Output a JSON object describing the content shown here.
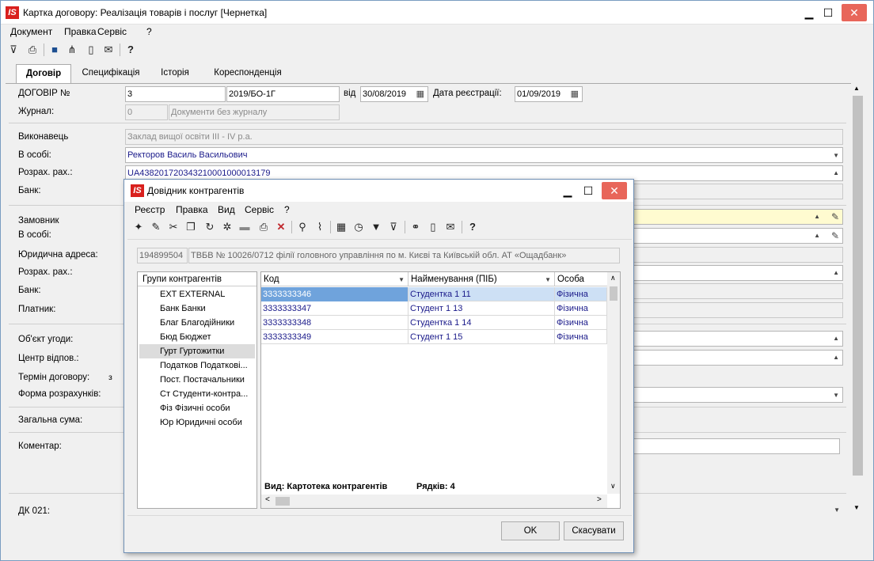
{
  "window": {
    "title": "Картка договору:  Реалізація товарів і послуг [Чернетка]",
    "logo": "IS",
    "controls": {
      "minimize": "▁",
      "maximize": "☐",
      "close": "✕"
    }
  },
  "menu": [
    "Документ",
    "Правка",
    "Сервіс",
    "?"
  ],
  "toolbar_icons": [
    "filter-icon",
    "print-icon",
    "save-icon",
    "tree-icon",
    "document-icon",
    "mail-icon",
    "help-icon"
  ],
  "tabs": [
    "Договір",
    "Специфікація",
    "Історія",
    "Кореспонденція"
  ],
  "form": {
    "contract_label": "ДОГОВІР №",
    "contract_num": "3",
    "contract_code": "2019/БО-1Г",
    "from_label": "від",
    "from_date": "30/08/2019",
    "reg_label": "Дата реєстрації:",
    "reg_date": "01/09/2019",
    "journal_label": "Журнал:",
    "journal_num": "0",
    "journal_value": "Документи без журналу",
    "executor_label": "Виконавець",
    "executor_value": "Заклад вищої освіти ІІІ - IV р.а.",
    "person_label": "В особі:",
    "person_value": "Ректоров Василь Васильович",
    "account_label": "Розрах. рах.:",
    "account_value": "UA438201720343210001000013179",
    "bank_label": "Банк:",
    "customer_label": "Замовник",
    "customer_person_label": "В особі:",
    "legal_addr_label": "Юридична адреса:",
    "account2_label": "Розрах. рах.:",
    "bank2_label": "Банк:",
    "payer_label": "Платник:",
    "subject_label": "Об'єкт угоди:",
    "cost_center_label": "Центр відпов.:",
    "term_label": "Термін договору:",
    "term_value": "з",
    "payment_form_label": "Форма розрахунків:",
    "total_label": "Загальна сума:",
    "comment_label": "Коментар:",
    "dk_label": "ДК 021:"
  },
  "dialog": {
    "title": "Довідник контрагентів",
    "logo": "IS",
    "menu": [
      "Реєстр",
      "Правка",
      "Вид",
      "Сервіс",
      "?"
    ],
    "search_code": "194899504",
    "search_text": "ТВБВ № 10026/0712 філії головного управління по м. Києві та Київській обл. АТ «Ощадбанк»",
    "groups_header": "Групи контрагентів",
    "groups": [
      "EXT EXTERNAL",
      "Банк Банки",
      "Благ Благодійники",
      "Бюд Бюджет",
      "Гурт Гуртожитки",
      "Податков Податкові...",
      "Пост. Постачальники",
      "Ст Студенти-контра...",
      "Фіз Фізичні особи",
      "Юр Юридичні особи"
    ],
    "selected_group": 4,
    "columns": [
      "Код",
      "Найменування (ПІБ)",
      "Особа"
    ],
    "rows": [
      {
        "code": "3333333346",
        "name": "Студентка 1 11",
        "type": "Фізична"
      },
      {
        "code": "3333333347",
        "name": "Студент 1 13",
        "type": "Фізична"
      },
      {
        "code": "3333333348",
        "name": "Студентка 1 14",
        "type": "Фізична"
      },
      {
        "code": "3333333349",
        "name": "Студент 1 15",
        "type": "Фізична"
      }
    ],
    "status_view": "Вид: Картотека контрагентів",
    "status_rows": "Рядків: 4",
    "ok": "OK",
    "cancel": "Скасувати"
  }
}
